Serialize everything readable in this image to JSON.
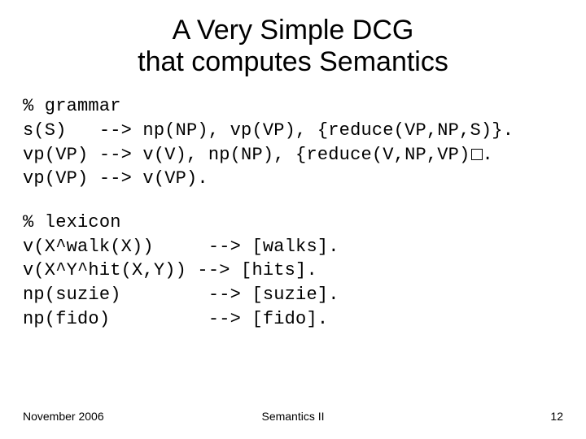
{
  "title_line1": "A Very Simple DCG",
  "title_line2": "that computes Semantics",
  "grammar_comment": "% grammar",
  "grammar_rule1": "s(S)   --> np(NP), vp(VP), {reduce(VP,NP,S)}.",
  "grammar_rule2_pre": "vp(VP) --> v(V), np(NP), {reduce(V,NP,VP)",
  "grammar_rule2_post": ".",
  "grammar_rule3": "vp(VP) --> v(VP).",
  "lexicon_comment": "% lexicon",
  "lexicon_rule1": "v(X^walk(X))     --> [walks].",
  "lexicon_rule2": "v(X^Y^hit(X,Y)) --> [hits].",
  "lexicon_rule3": "np(suzie)        --> [suzie].",
  "lexicon_rule4": "np(fido)         --> [fido].",
  "footer_left": "November 2006",
  "footer_center": "Semantics II",
  "footer_right": "12"
}
